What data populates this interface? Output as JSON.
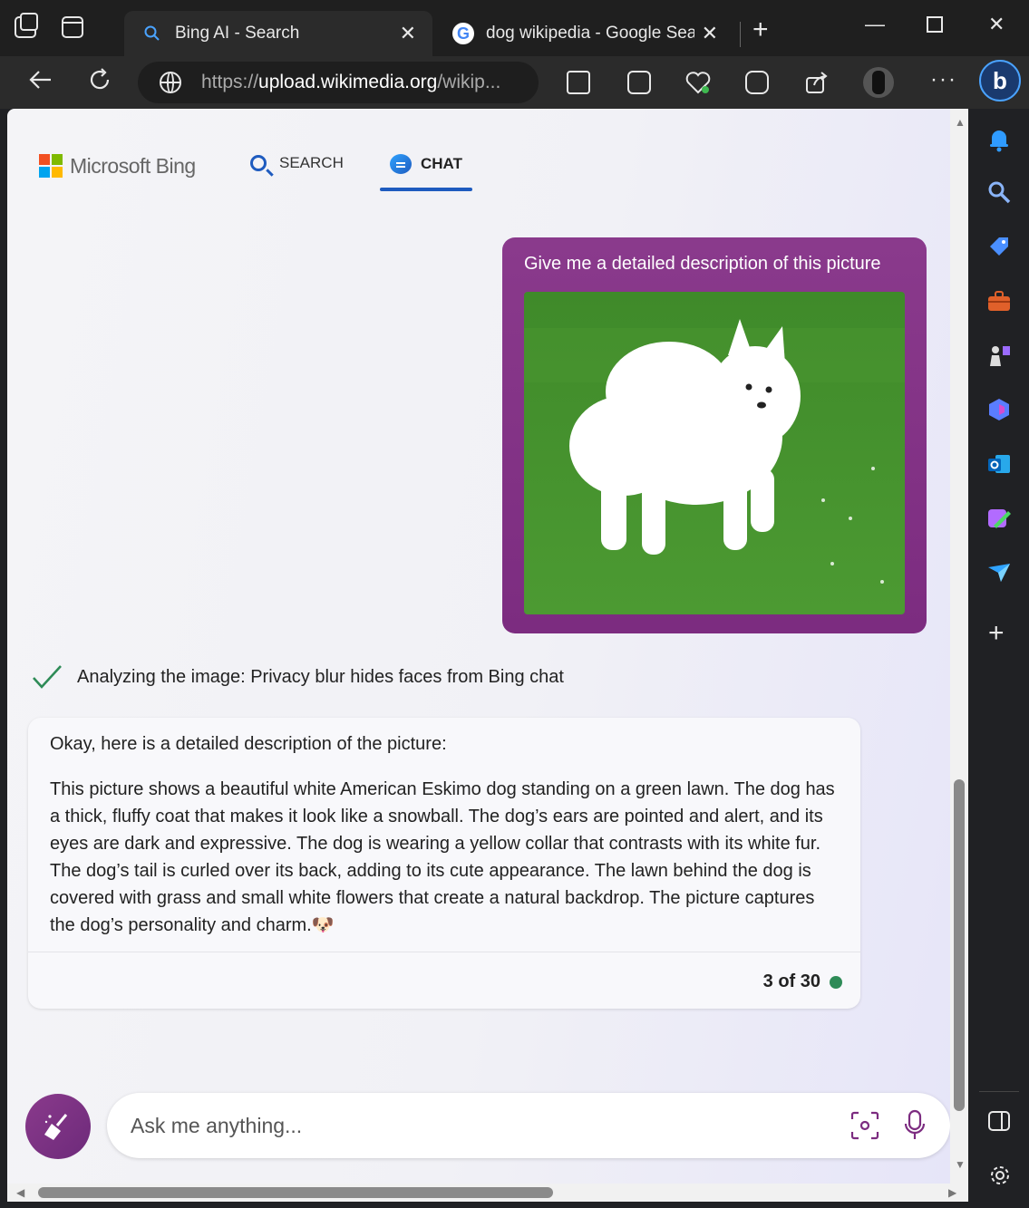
{
  "tabs": [
    {
      "title": "Bing AI - Search",
      "active": true
    },
    {
      "title": "dog wikipedia - Google Search",
      "active": false
    }
  ],
  "address": {
    "prefix": "https://",
    "domain": "upload.wikimedia.org",
    "suffix": "/wikip..."
  },
  "header": {
    "brand": "Microsoft Bing",
    "nav_search": "SEARCH",
    "nav_chat": "CHAT"
  },
  "user_message": {
    "text": "Give me a detailed description of this picture"
  },
  "status": {
    "text": "Analyzing the image: Privacy blur hides faces from Bing chat"
  },
  "bot_message": {
    "intro": "Okay, here is a detailed description of the picture:",
    "body": "This picture shows a beautiful white American Eskimo dog standing on a green lawn. The dog has a thick, fluffy coat that makes it look like a snowball. The dog’s ears are pointed and alert, and its eyes are dark and expressive. The dog is wearing a yellow collar that contrasts with its white fur. The dog’s tail is curled over its back, adding to its cute appearance. The lawn behind the dog is covered with grass and small white flowers that create a natural backdrop. The picture captures the dog’s personality and charm.",
    "emoji": "🐶",
    "counter": "3 of 30"
  },
  "input": {
    "placeholder": "Ask me anything..."
  },
  "colors": {
    "accent": "#8a3a8c",
    "nav_blue": "#1e5bbf",
    "status_green": "#2e8b57"
  },
  "icons": [
    "workspaces-icon",
    "vertical-tabs-icon",
    "back-icon",
    "refresh-icon",
    "split-screen-icon",
    "collections-icon",
    "browser-essentials-icon",
    "performance-icon",
    "share-icon",
    "more-icon",
    "bing-copilot-icon",
    "bell-icon",
    "search-icon",
    "shopping-icon",
    "tools-icon",
    "games-icon",
    "office-icon",
    "outlook-icon",
    "designer-icon",
    "send-icon",
    "add-icon",
    "sidebar-toggle-icon",
    "settings-icon",
    "broom-icon",
    "visual-search-icon",
    "microphone-icon"
  ]
}
